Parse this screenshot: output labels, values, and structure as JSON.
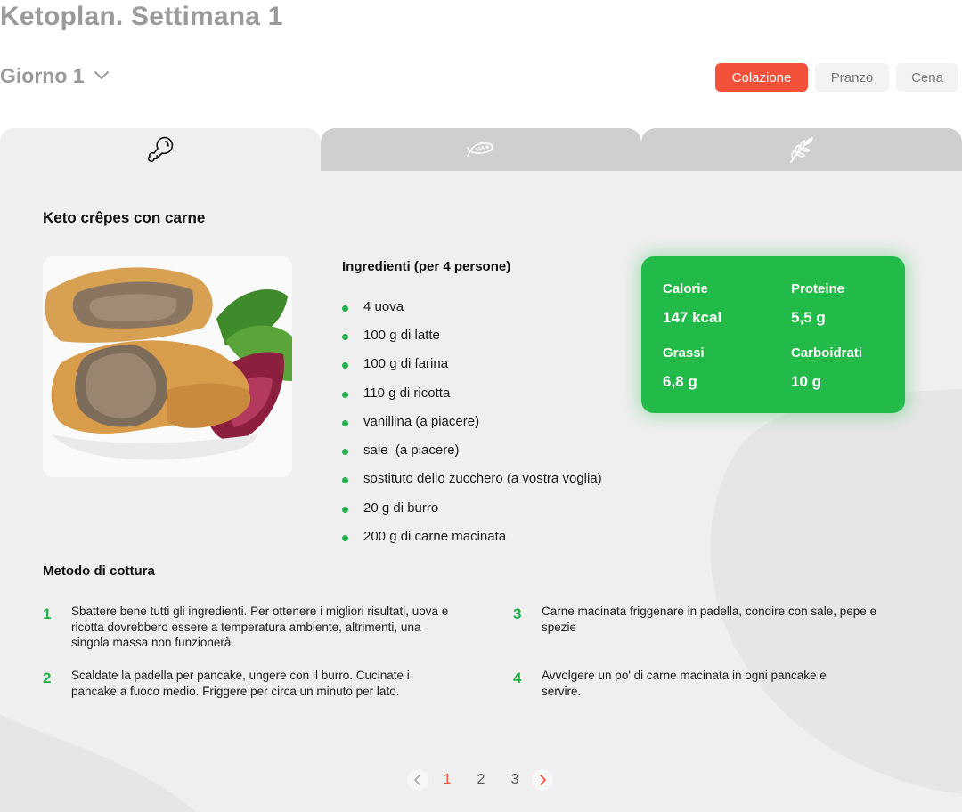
{
  "header": {
    "title": "Ketoplan. Settimana 1",
    "day_label": "Giorno 1"
  },
  "meals": [
    "Colazione",
    "Pranzo",
    "Cena"
  ],
  "active_meal": "Colazione",
  "type_tabs": [
    {
      "icon": "drumstick-icon",
      "active": true
    },
    {
      "icon": "fish-icon",
      "active": false
    },
    {
      "icon": "leaf-icon",
      "active": false
    }
  ],
  "recipe": {
    "title": "Keto crêpes con carne",
    "photo_alt": "crepes-with-meat-image"
  },
  "ingredients": {
    "title": "Ingredienti (per 4 persone)",
    "items": [
      "4 uova",
      "100 g di latte",
      "100 g di farina",
      "110 g di ricotta",
      "vanillina (a piacere)",
      "sale  (a piacere)",
      "sostituto dello zucchero (a vostra voglia)",
      "20 g di burro",
      "200 g di carne macinata"
    ]
  },
  "nutrition": {
    "calorie_label": "Calorie",
    "calorie_value": "147 kcal",
    "proteine_label": "Proteine",
    "proteine_value": "5,5 g",
    "grassi_label": "Grassi",
    "grassi_value": "6,8 g",
    "carbo_label": "Carboidrati",
    "carbo_value": "10 g"
  },
  "method": {
    "title": "Metodo di cottura",
    "steps": [
      {
        "num": "1",
        "text": "Sbattere bene tutti gli ingredienti. Per ottenere i migliori risultati, uova e ricotta dovrebbero essere a temperatura ambiente, altrimenti, una singola massa non funzionerà."
      },
      {
        "num": "2",
        "text": "Scaldate la padella per pancake, ungere con il burro. Cucinate i pancake a fuoco medio. Friggere per circa un minuto per lato."
      },
      {
        "num": "3",
        "text": "Carne macinata friggenare in padella, condire con sale, pepe e spezie"
      },
      {
        "num": "4",
        "text": "Avvolgere un po' di carne macinata in ogni pancake e servire."
      }
    ]
  },
  "pagination": {
    "pages": [
      "1",
      "2",
      "3"
    ],
    "current": "1"
  },
  "colors": {
    "accent_red": "#f4513b",
    "accent_green": "#22bb4a",
    "card_bg": "#efefef",
    "title_gray": "#9a9a9a"
  }
}
